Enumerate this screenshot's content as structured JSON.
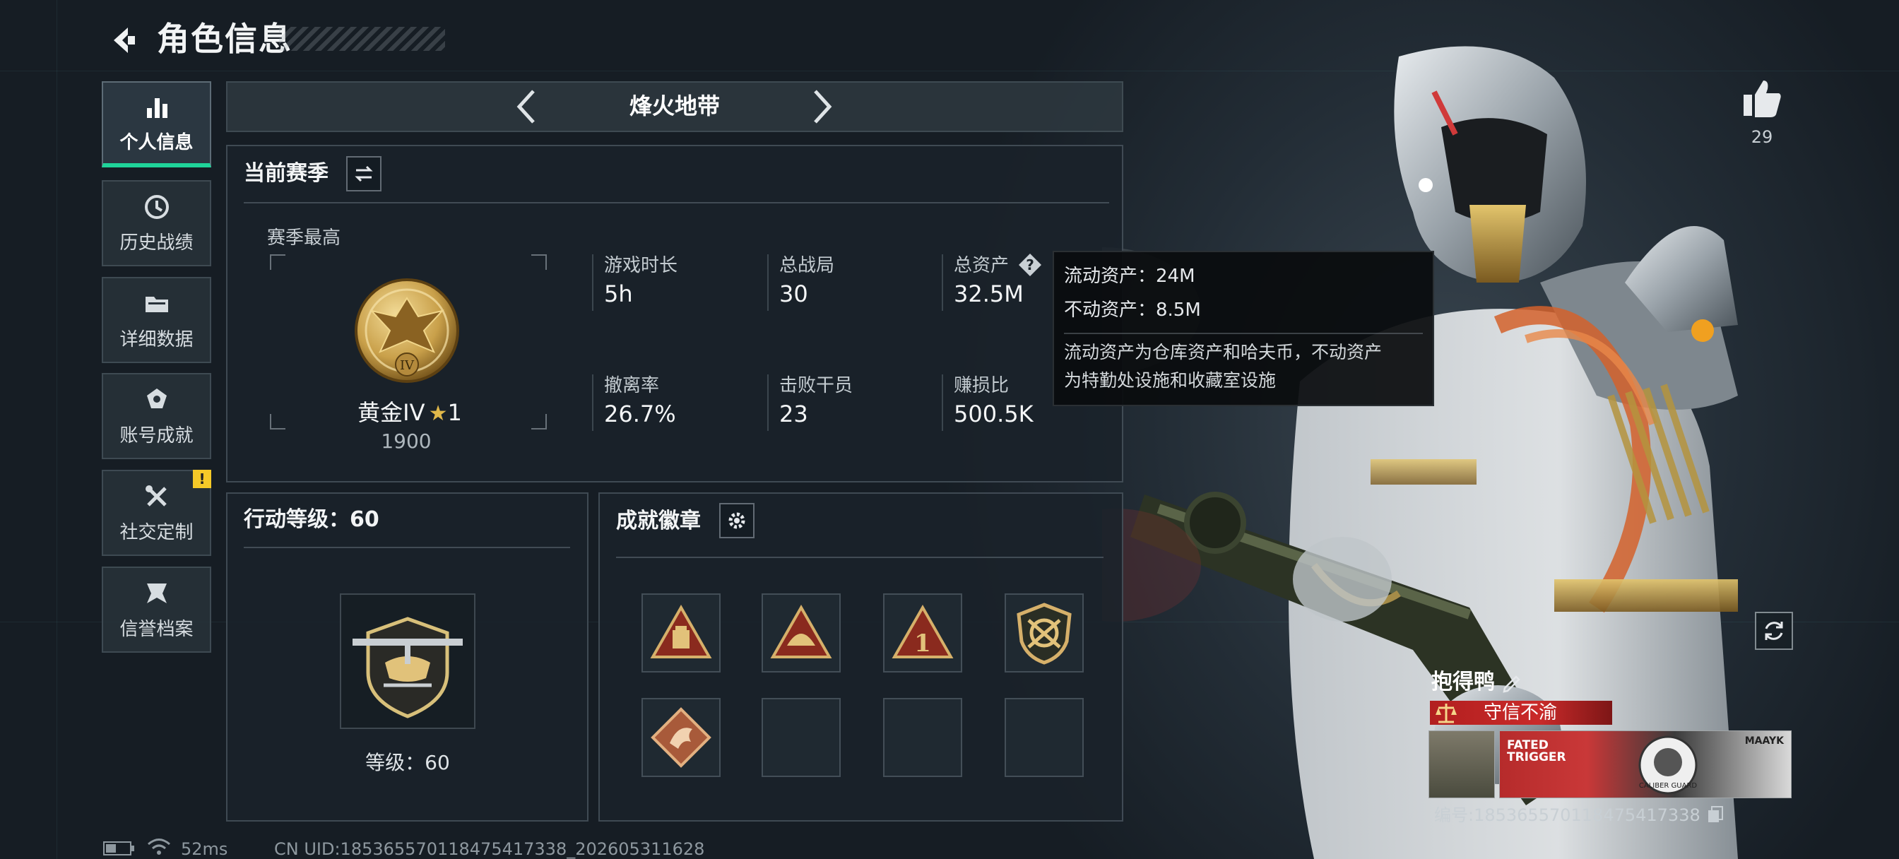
{
  "header": {
    "title": "角色信息"
  },
  "nav": {
    "items": [
      {
        "label": "个人信息",
        "icon": "bar-chart-icon",
        "active": true
      },
      {
        "label": "历史战绩",
        "icon": "history-clock-icon",
        "active": false
      },
      {
        "label": "详细数据",
        "icon": "folder-icon",
        "active": false
      },
      {
        "label": "账号成就",
        "icon": "achievement-medal-icon",
        "active": false
      },
      {
        "label": "社交定制",
        "icon": "tools-icon",
        "active": false,
        "badge": "!"
      },
      {
        "label": "信誉档案",
        "icon": "credit-shield-icon",
        "active": false
      }
    ]
  },
  "mode": {
    "title": "烽火地带"
  },
  "season": {
    "title": "当前赛季",
    "best_label": "赛季最高",
    "rank_name": "黄金IV",
    "rank_stars": "1",
    "rank_score": "1900",
    "rank_numeral": "IV",
    "stats": [
      {
        "label": "游戏时长",
        "value": "5h"
      },
      {
        "label": "总战局",
        "value": "30"
      },
      {
        "label": "总资产",
        "value": "32.5M",
        "has_help": true
      },
      {
        "label": "撤离率",
        "value": "26.7%"
      },
      {
        "label": "击败干员",
        "value": "23"
      },
      {
        "label": "赚损比",
        "value": "500.5K"
      }
    ]
  },
  "tooltip": {
    "liquid": "流动资产：24M",
    "fixed": "不动资产：8.5M",
    "desc_line1": "流动资产为仓库资产和哈夫币，不动资产",
    "desc_line2": "为特勤处设施和收藏室设施"
  },
  "action_level": {
    "title": "行动等级：60",
    "level_text": "等级：60"
  },
  "achievements": {
    "title": "成就徽章",
    "badges": [
      "supply-triangle-badge",
      "helmet-triangle-badge",
      "number-one-triangle-badge",
      "crossed-guns-shield-badge",
      "dragon-diamond-badge",
      "empty",
      "empty",
      "empty"
    ]
  },
  "footer": {
    "ping": "52ms",
    "uid": "CN UID:1853655701184754173​38_202605311628"
  },
  "player": {
    "likes": "29",
    "name": "抱得鸭",
    "honor": "守信不渝",
    "card_text_left": "FATED TRIGGER",
    "card_text_right": "MAAYK",
    "card_text_bottom": "CALIBER GUARD",
    "id_line": "编号:185365570118475417338"
  },
  "colors": {
    "accent_green": "#1fd49a",
    "warning_yellow": "#f5c928",
    "honor_red": "#c92a2a",
    "medal_gold": "#c9a04a"
  }
}
